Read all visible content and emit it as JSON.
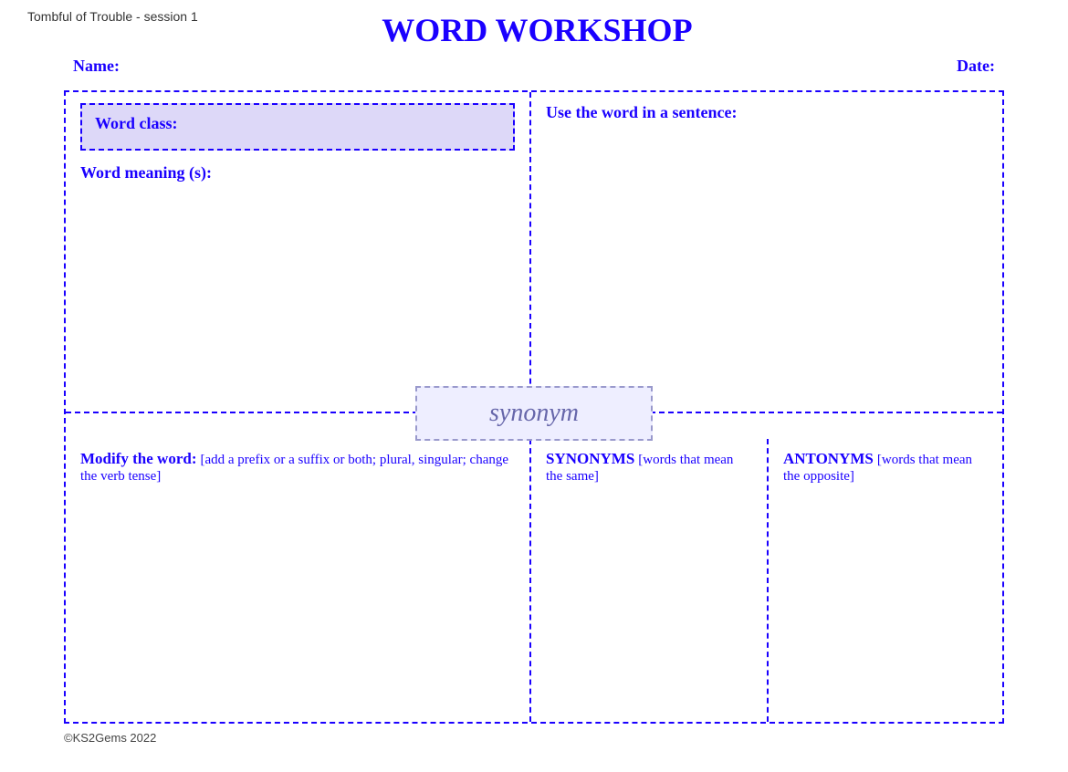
{
  "header": {
    "subtitle": "Tombful of Trouble - session 1",
    "title": "WORD WORKSHOP"
  },
  "name_row": {
    "name_label": "Name:",
    "date_label": "Date:"
  },
  "left_panel": {
    "word_class_label": "Word class:",
    "word_meaning_label": "Word meaning (s):"
  },
  "right_panel": {
    "use_sentence_label": "Use the word in a sentence:"
  },
  "synonym_box": {
    "text": "synonym"
  },
  "bottom": {
    "modify_label": "Modify the word:",
    "modify_detail": "[add a prefix or a suffix or both; plural, singular; change the verb tense]",
    "synonyms_label": "SYNONYMS",
    "synonyms_detail": "[words that mean the same]",
    "antonyms_label": "ANTONYMS",
    "antonyms_detail": "[words that mean the opposite]"
  },
  "footer": {
    "text": "©KS2Gems 2022"
  }
}
